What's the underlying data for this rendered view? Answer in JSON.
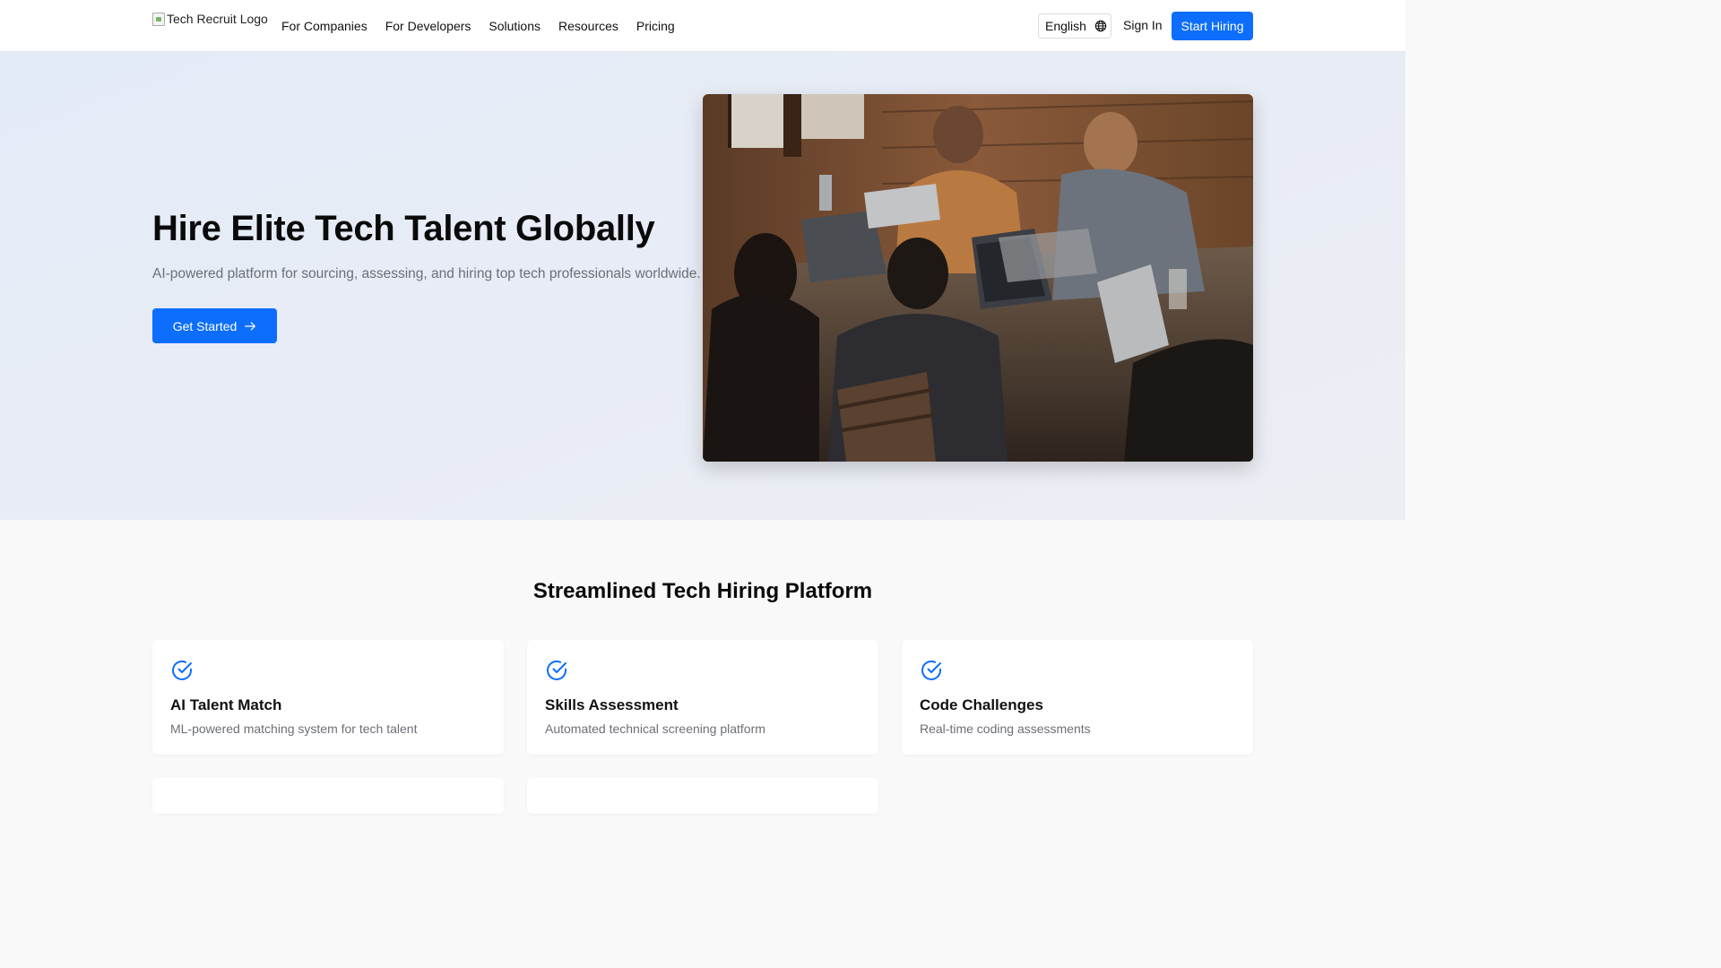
{
  "header": {
    "logo_alt": "Tech Recruit Logo",
    "nav": [
      "For Companies",
      "For Developers",
      "Solutions",
      "Resources",
      "Pricing"
    ],
    "language": "English",
    "sign_in": "Sign In",
    "start_hiring": "Start Hiring"
  },
  "hero": {
    "title": "Hire Elite Tech Talent Globally",
    "subtitle": "AI-powered platform for sourcing, assessing, and hiring top tech professionals worldwide.",
    "cta_label": "Get Started"
  },
  "features": {
    "title": "Streamlined Tech Hiring Platform",
    "cards": [
      {
        "title": "AI Talent Match",
        "desc": "ML-powered matching system for tech talent"
      },
      {
        "title": "Skills Assessment",
        "desc": "Automated technical screening platform"
      },
      {
        "title": "Code Challenges",
        "desc": "Real-time coding assessments"
      }
    ]
  },
  "colors": {
    "accent": "#0d6efd",
    "muted_text": "#6b6f76",
    "hero_bg": "#e6ebf6"
  }
}
